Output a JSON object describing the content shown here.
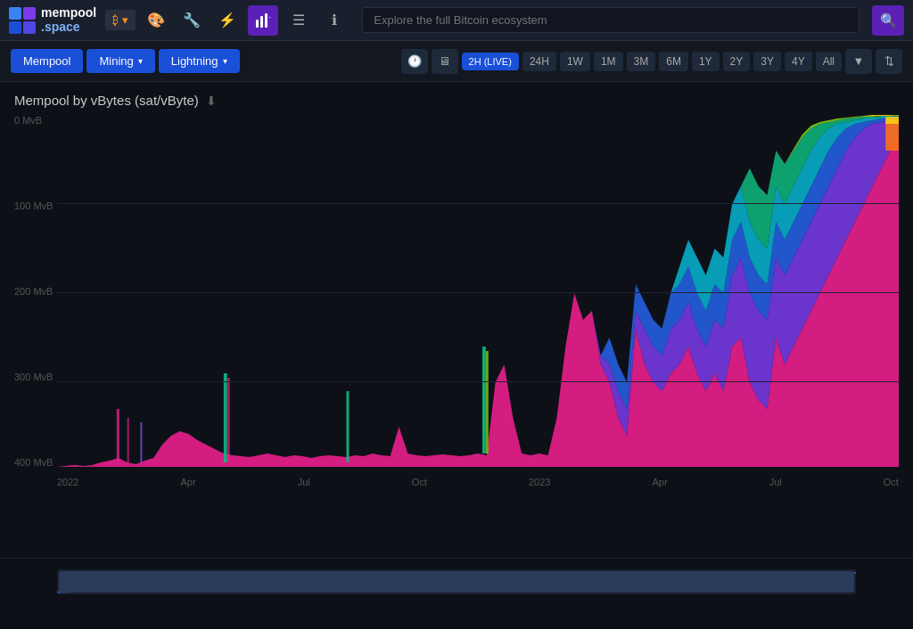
{
  "header": {
    "logo_name": "mempool",
    "logo_sub": ".space",
    "search_placeholder": "Explore the full Bitcoin ecosystem",
    "bitcoin_price": "₿",
    "icons": {
      "bitcoin": "₿",
      "palette": "🎨",
      "wrench": "🔧",
      "lightning": "⚡",
      "chart": "📊",
      "list": "☰",
      "info": "ℹ",
      "search": "🔍"
    }
  },
  "navbar": {
    "mempool_label": "Mempool",
    "mining_label": "Mining",
    "lightning_label": "Lightning",
    "time_buttons": [
      {
        "label": "2H (LIVE)",
        "active": true
      },
      {
        "label": "24H",
        "active": false
      },
      {
        "label": "1W",
        "active": false
      },
      {
        "label": "1M",
        "active": false
      },
      {
        "label": "3M",
        "active": false
      },
      {
        "label": "6M",
        "active": false
      },
      {
        "label": "1Y",
        "active": false
      },
      {
        "label": "2Y",
        "active": false
      },
      {
        "label": "3Y",
        "active": false
      },
      {
        "label": "4Y",
        "active": false
      },
      {
        "label": "All",
        "active": false
      }
    ]
  },
  "chart": {
    "title": "Mempool by vBytes (sat/vByte)",
    "y_labels": [
      "400 MvB",
      "300 MvB",
      "200 MvB",
      "100 MvB",
      "0 MvB"
    ],
    "x_labels": [
      "2022",
      "Apr",
      "Jul",
      "Oct",
      "2023",
      "Apr",
      "Jul",
      "Oct"
    ],
    "colors": {
      "band1": "#f0148c",
      "band2": "#8b5cf6",
      "band3": "#3b82f6",
      "band4": "#06b6d4",
      "band5": "#10b981",
      "band6": "#84cc16",
      "band7": "#facc15",
      "band8": "#f97316"
    }
  },
  "scrollbar": {
    "label": "scroll-handle"
  }
}
